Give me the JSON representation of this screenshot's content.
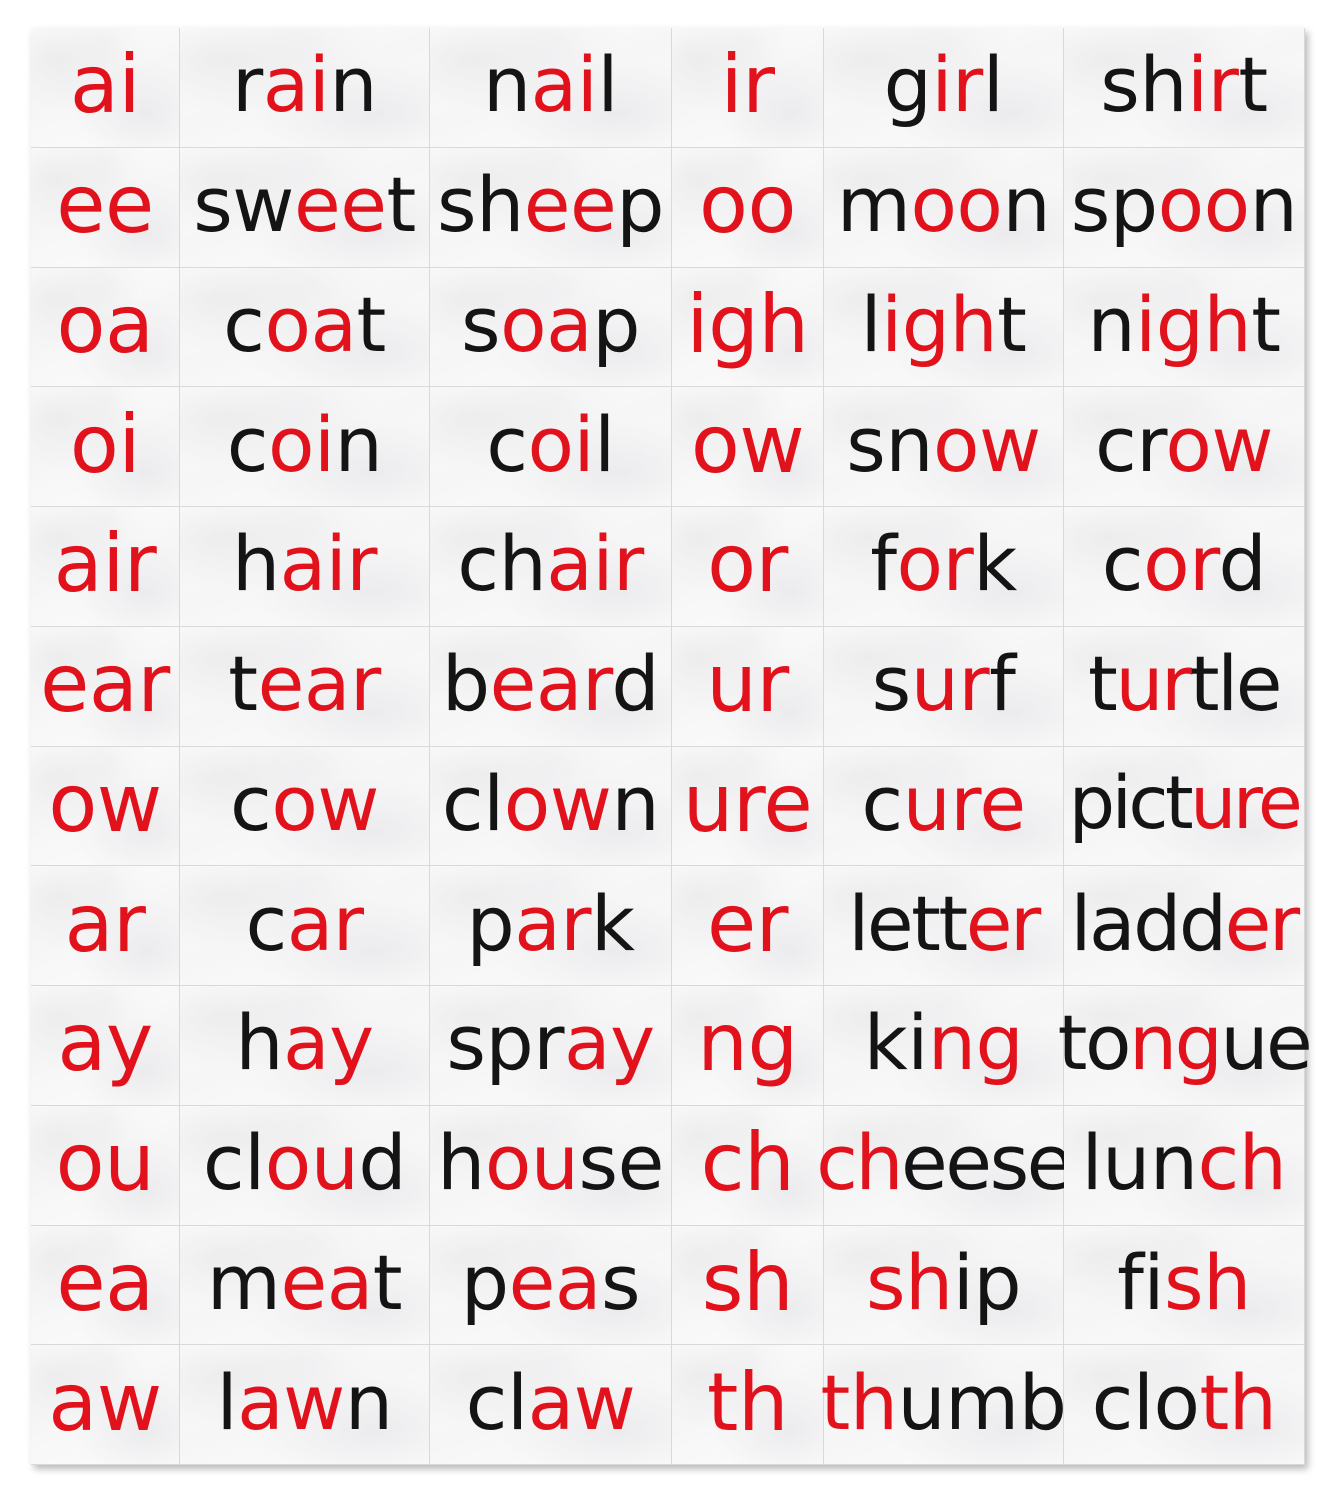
{
  "document": {
    "title": "Phonics Digraph and Trigraph Word Chart",
    "colors": {
      "highlight": "#e1121b",
      "text": "#141414",
      "card": "#fbfbfb",
      "grid_line": "#d9d9d9",
      "page_background": "#ffffff"
    },
    "layout": {
      "columns": 6,
      "rows": 12,
      "column_kinds": [
        "grapheme",
        "word",
        "word",
        "grapheme",
        "word",
        "word"
      ],
      "note": "Columns 1 and 4 show the grapheme fully in red; word columns show the matching grapheme letters in red within an otherwise black word."
    }
  },
  "chart_rows": [
    {
      "left": {
        "grapheme": "ai",
        "word1": "rain",
        "word1_parts": [
          {
            "t": "r",
            "c": "k"
          },
          {
            "t": "ai",
            "c": "r"
          },
          {
            "t": "n",
            "c": "k"
          }
        ],
        "word2": "nail",
        "word2_parts": [
          {
            "t": "n",
            "c": "k"
          },
          {
            "t": "ai",
            "c": "r"
          },
          {
            "t": "l",
            "c": "k"
          }
        ]
      },
      "right": {
        "grapheme": "ir",
        "word1": "girl",
        "word1_parts": [
          {
            "t": "g",
            "c": "k"
          },
          {
            "t": "ir",
            "c": "r"
          },
          {
            "t": "l",
            "c": "k"
          }
        ],
        "word2": "shirt",
        "word2_parts": [
          {
            "t": "sh",
            "c": "k"
          },
          {
            "t": "ir",
            "c": "r"
          },
          {
            "t": "t",
            "c": "k"
          }
        ]
      }
    },
    {
      "left": {
        "grapheme": "ee",
        "word1": "sweet",
        "word1_parts": [
          {
            "t": "sw",
            "c": "k"
          },
          {
            "t": "ee",
            "c": "r"
          },
          {
            "t": "t",
            "c": "k"
          }
        ],
        "word2": "sheep",
        "word2_parts": [
          {
            "t": "sh",
            "c": "k"
          },
          {
            "t": "ee",
            "c": "r"
          },
          {
            "t": "p",
            "c": "k"
          }
        ]
      },
      "right": {
        "grapheme": "oo",
        "word1": "moon",
        "word1_parts": [
          {
            "t": "m",
            "c": "k"
          },
          {
            "t": "oo",
            "c": "r"
          },
          {
            "t": "n",
            "c": "k"
          }
        ],
        "word2": "spoon",
        "word2_parts": [
          {
            "t": "sp",
            "c": "k"
          },
          {
            "t": "oo",
            "c": "r"
          },
          {
            "t": "n",
            "c": "k"
          }
        ]
      }
    },
    {
      "left": {
        "grapheme": "oa",
        "word1": "coat",
        "word1_parts": [
          {
            "t": "c",
            "c": "k"
          },
          {
            "t": "oa",
            "c": "r"
          },
          {
            "t": "t",
            "c": "k"
          }
        ],
        "word2": "soap",
        "word2_parts": [
          {
            "t": "s",
            "c": "k"
          },
          {
            "t": "oa",
            "c": "r"
          },
          {
            "t": "p",
            "c": "k"
          }
        ]
      },
      "right": {
        "grapheme": "igh",
        "word1": "light",
        "word1_parts": [
          {
            "t": "l",
            "c": "k"
          },
          {
            "t": "igh",
            "c": "r"
          },
          {
            "t": "t",
            "c": "k"
          }
        ],
        "word2": "night",
        "word2_parts": [
          {
            "t": "n",
            "c": "k"
          },
          {
            "t": "igh",
            "c": "r"
          },
          {
            "t": "t",
            "c": "k"
          }
        ]
      }
    },
    {
      "left": {
        "grapheme": "oi",
        "word1": "coin",
        "word1_parts": [
          {
            "t": "c",
            "c": "k"
          },
          {
            "t": "oi",
            "c": "r"
          },
          {
            "t": "n",
            "c": "k"
          }
        ],
        "word2": "coil",
        "word2_parts": [
          {
            "t": "c",
            "c": "k"
          },
          {
            "t": "oi",
            "c": "r"
          },
          {
            "t": "l",
            "c": "k"
          }
        ]
      },
      "right": {
        "grapheme": "ow",
        "word1": "snow",
        "word1_parts": [
          {
            "t": "sn",
            "c": "k"
          },
          {
            "t": "ow",
            "c": "r"
          }
        ],
        "word2": "crow",
        "word2_parts": [
          {
            "t": "cr",
            "c": "k"
          },
          {
            "t": "ow",
            "c": "r"
          }
        ]
      }
    },
    {
      "left": {
        "grapheme": "air",
        "word1": "hair",
        "word1_parts": [
          {
            "t": "h",
            "c": "k"
          },
          {
            "t": "air",
            "c": "r"
          }
        ],
        "word2": "chair",
        "word2_parts": [
          {
            "t": "ch",
            "c": "k"
          },
          {
            "t": "air",
            "c": "r"
          }
        ]
      },
      "right": {
        "grapheme": "or",
        "word1": "fork",
        "word1_parts": [
          {
            "t": "f",
            "c": "k"
          },
          {
            "t": "or",
            "c": "r"
          },
          {
            "t": "k",
            "c": "k"
          }
        ],
        "word2": "cord",
        "word2_parts": [
          {
            "t": "c",
            "c": "k"
          },
          {
            "t": "or",
            "c": "r"
          },
          {
            "t": "d",
            "c": "k"
          }
        ]
      }
    },
    {
      "left": {
        "grapheme": "ear",
        "word1": "tear",
        "word1_parts": [
          {
            "t": "t",
            "c": "k"
          },
          {
            "t": "ear",
            "c": "r"
          }
        ],
        "word2": "beard",
        "word2_parts": [
          {
            "t": "b",
            "c": "k"
          },
          {
            "t": "ear",
            "c": "r"
          },
          {
            "t": "d",
            "c": "k"
          }
        ]
      },
      "right": {
        "grapheme": "ur",
        "word1": "surf",
        "word1_parts": [
          {
            "t": "s",
            "c": "k"
          },
          {
            "t": "ur",
            "c": "r"
          },
          {
            "t": "f",
            "c": "k"
          }
        ],
        "word2": "turtle",
        "word2_parts": [
          {
            "t": "t",
            "c": "k"
          },
          {
            "t": "ur",
            "c": "r"
          },
          {
            "t": "tle",
            "c": "k"
          }
        ]
      }
    },
    {
      "left": {
        "grapheme": "ow",
        "word1": "cow",
        "word1_parts": [
          {
            "t": "c",
            "c": "k"
          },
          {
            "t": "ow",
            "c": "r"
          }
        ],
        "word2": "clown",
        "word2_parts": [
          {
            "t": "cl",
            "c": "k"
          },
          {
            "t": "ow",
            "c": "r"
          },
          {
            "t": "n",
            "c": "k"
          }
        ]
      },
      "right": {
        "grapheme": "ure",
        "word1": "cure",
        "word1_parts": [
          {
            "t": "c",
            "c": "k"
          },
          {
            "t": "ure",
            "c": "r"
          }
        ],
        "word2": "picture",
        "word2_parts": [
          {
            "t": "pict",
            "c": "k"
          },
          {
            "t": "ure",
            "c": "r"
          }
        ]
      }
    },
    {
      "left": {
        "grapheme": "ar",
        "word1": "car",
        "word1_parts": [
          {
            "t": "c",
            "c": "k"
          },
          {
            "t": "ar",
            "c": "r"
          }
        ],
        "word2": "park",
        "word2_parts": [
          {
            "t": "p",
            "c": "k"
          },
          {
            "t": "ar",
            "c": "r"
          },
          {
            "t": "k",
            "c": "k"
          }
        ]
      },
      "right": {
        "grapheme": "er",
        "word1": "letter",
        "word1_parts": [
          {
            "t": "lett",
            "c": "k"
          },
          {
            "t": "er",
            "c": "r"
          }
        ],
        "word2": "ladder",
        "word2_parts": [
          {
            "t": "ladd",
            "c": "k"
          },
          {
            "t": "er",
            "c": "r"
          }
        ]
      }
    },
    {
      "left": {
        "grapheme": "ay",
        "word1": "hay",
        "word1_parts": [
          {
            "t": "h",
            "c": "k"
          },
          {
            "t": "ay",
            "c": "r"
          }
        ],
        "word2": "spray",
        "word2_parts": [
          {
            "t": "spr",
            "c": "k"
          },
          {
            "t": "ay",
            "c": "r"
          }
        ]
      },
      "right": {
        "grapheme": "ng",
        "word1": "king",
        "word1_parts": [
          {
            "t": "ki",
            "c": "k"
          },
          {
            "t": "ng",
            "c": "r"
          }
        ],
        "word2": "tongue",
        "word2_parts": [
          {
            "t": "to",
            "c": "k"
          },
          {
            "t": "ng",
            "c": "r"
          },
          {
            "t": "ue",
            "c": "k"
          }
        ]
      }
    },
    {
      "left": {
        "grapheme": "ou",
        "word1": "cloud",
        "word1_parts": [
          {
            "t": "cl",
            "c": "k"
          },
          {
            "t": "ou",
            "c": "r"
          },
          {
            "t": "d",
            "c": "k"
          }
        ],
        "word2": "house",
        "word2_parts": [
          {
            "t": "h",
            "c": "k"
          },
          {
            "t": "ou",
            "c": "r"
          },
          {
            "t": "se",
            "c": "k"
          }
        ]
      },
      "right": {
        "grapheme": "ch",
        "word1": "cheese",
        "word1_parts": [
          {
            "t": "ch",
            "c": "r"
          },
          {
            "t": "eese",
            "c": "k"
          }
        ],
        "word2": "lunch",
        "word2_parts": [
          {
            "t": "lun",
            "c": "k"
          },
          {
            "t": "ch",
            "c": "r"
          }
        ]
      }
    },
    {
      "left": {
        "grapheme": "ea",
        "word1": "meat",
        "word1_parts": [
          {
            "t": "m",
            "c": "k"
          },
          {
            "t": "ea",
            "c": "r"
          },
          {
            "t": "t",
            "c": "k"
          }
        ],
        "word2": "peas",
        "word2_parts": [
          {
            "t": "p",
            "c": "k"
          },
          {
            "t": "ea",
            "c": "r"
          },
          {
            "t": "s",
            "c": "k"
          }
        ]
      },
      "right": {
        "grapheme": "sh",
        "word1": "ship",
        "word1_parts": [
          {
            "t": "sh",
            "c": "r"
          },
          {
            "t": "ip",
            "c": "k"
          }
        ],
        "word2": "fish",
        "word2_parts": [
          {
            "t": "fi",
            "c": "k"
          },
          {
            "t": "sh",
            "c": "r"
          }
        ]
      }
    },
    {
      "left": {
        "grapheme": "aw",
        "word1": "lawn",
        "word1_parts": [
          {
            "t": "l",
            "c": "k"
          },
          {
            "t": "aw",
            "c": "r"
          },
          {
            "t": "n",
            "c": "k"
          }
        ],
        "word2": "claw",
        "word2_parts": [
          {
            "t": "cl",
            "c": "k"
          },
          {
            "t": "aw",
            "c": "r"
          }
        ]
      },
      "right": {
        "grapheme": "th",
        "word1": "thumb",
        "word1_parts": [
          {
            "t": "th",
            "c": "r"
          },
          {
            "t": "umb",
            "c": "k"
          }
        ],
        "word2": "cloth",
        "word2_parts": [
          {
            "t": "clo",
            "c": "k"
          },
          {
            "t": "th",
            "c": "r"
          }
        ]
      }
    }
  ]
}
